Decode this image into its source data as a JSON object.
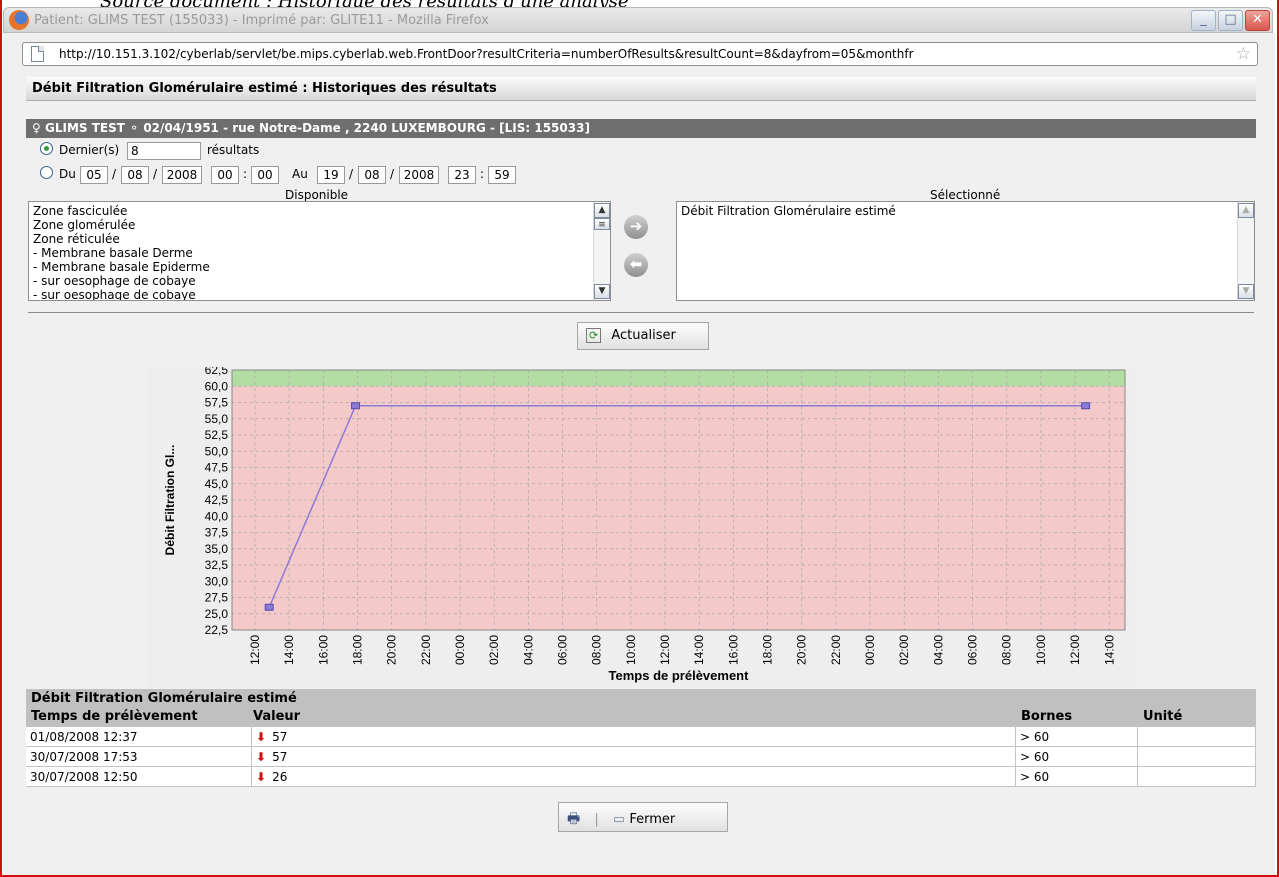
{
  "caption": "Source document : Historique des résultats d'une analyse",
  "window": {
    "title": "Patient: GLIMS TEST (155033) - Imprimé par: GLITE11 - Mozilla Firefox",
    "url": "http://10.151.3.102/cyberlab/servlet/be.mips.cyberlab.web.FrontDoor?resultCriteria=numberOfResults&resultCount=8&dayfrom=05&monthfr",
    "minimize_icon": "minimize-icon",
    "maximize_icon": "maximize-icon",
    "close_icon": "close-icon"
  },
  "section_title": "Débit Filtration Glomérulaire estimé : Historiques des résultats",
  "patient": {
    "gender_icon": "female-icon",
    "info": "GLIMS TEST  ⚬ 02/04/1951 - rue Notre-Dame , 2240 LUXEMBOURG - [LIS: 155033]"
  },
  "filter": {
    "last_label": "Dernier(s)",
    "last_count": "8",
    "results_label": "résultats",
    "du_label": "Du",
    "from": {
      "day": "05",
      "month": "08",
      "year": "2008",
      "hour": "00",
      "minute": "00"
    },
    "au_label": "Au",
    "to": {
      "day": "19",
      "month": "08",
      "year": "2008",
      "hour": "23",
      "minute": "59"
    },
    "date_sep": "/",
    "time_sep": ":"
  },
  "available": {
    "label": "Disponible",
    "items": [
      "Zone fasciculée",
      "Zone glomérulée",
      "Zone réticulée",
      "- Membrane basale Derme",
      "- Membrane basale Epiderme",
      "- sur oesophage de cobaye",
      "- sur oesophage de cobaye"
    ]
  },
  "selected": {
    "label": "Sélectionné",
    "items": [
      "Débit Filtration Glomérulaire estimé"
    ]
  },
  "refresh_button": "Actualiser",
  "chart_data": {
    "type": "line",
    "ylabel": "Débit Filtration Gl...",
    "xlabel": "Temps de prélèvement",
    "ylim": [
      22.5,
      62.5
    ],
    "yticks": [
      "62,5",
      "60,0",
      "57,5",
      "55,0",
      "52,5",
      "50,0",
      "47,5",
      "45,0",
      "42,5",
      "40,0",
      "37,5",
      "35,0",
      "32,5",
      "30,0",
      "27,5",
      "25,0",
      "22,5"
    ],
    "xticks": [
      "12:00",
      "14:00",
      "16:00",
      "18:00",
      "20:00",
      "22:00",
      "00:00",
      "02:00",
      "04:00",
      "06:00",
      "08:00",
      "10:00",
      "12:00",
      "14:00",
      "16:00",
      "18:00",
      "20:00",
      "22:00",
      "00:00",
      "02:00",
      "04:00",
      "06:00",
      "08:00",
      "10:00",
      "12:00",
      "14:00"
    ],
    "normal_band": [
      60.0,
      62.5
    ],
    "colors": {
      "normal": "#b3dca2",
      "abnormal": "#f4c9c9",
      "line": "#8a7bd6"
    },
    "series": [
      {
        "x": [
          "30/07/2008 12:50",
          "30/07/2008 17:53",
          "01/08/2008 12:37"
        ],
        "values": [
          26,
          57,
          57
        ]
      }
    ]
  },
  "table": {
    "title": "Débit Filtration Glomérulaire estimé",
    "headers": {
      "time": "Temps de prélèvement",
      "value": "Valeur",
      "range": "Bornes",
      "unit": "Unité"
    },
    "rows": [
      {
        "time": "01/08/2008 12:37",
        "value": "57",
        "range": "> 60",
        "unit": ""
      },
      {
        "time": "30/07/2008 17:53",
        "value": "57",
        "range": "> 60",
        "unit": ""
      },
      {
        "time": "30/07/2008 12:50",
        "value": "26",
        "range": "> 60",
        "unit": ""
      }
    ]
  },
  "footer": {
    "print_icon": "printer-icon",
    "close_label": "Fermer"
  }
}
